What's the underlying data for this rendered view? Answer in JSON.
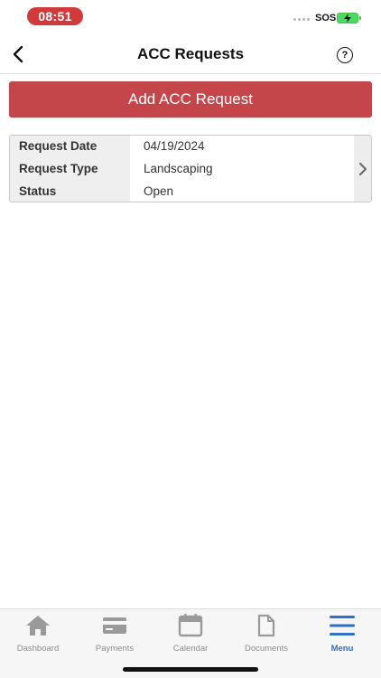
{
  "status_bar": {
    "time": "08:51",
    "carrier": "SOS"
  },
  "nav": {
    "title": "ACC Requests",
    "help_symbol": "?",
    "back_icon": "chevron-left-icon",
    "help_icon": "question-circle-icon"
  },
  "add_button": {
    "label": "Add ACC Request",
    "color": "#c4464a"
  },
  "request": {
    "date_label": "Request Date",
    "date_value": "04/19/2024",
    "type_label": "Request Type",
    "type_value": "Landscaping",
    "status_label": "Status",
    "status_value": "Open"
  },
  "tabs": [
    {
      "label": "Dashboard",
      "icon": "home-icon",
      "active": false
    },
    {
      "label": "Payments",
      "icon": "credit-card-icon",
      "active": false
    },
    {
      "label": "Calendar",
      "icon": "calendar-icon",
      "active": false
    },
    {
      "label": "Documents",
      "icon": "document-icon",
      "active": false
    },
    {
      "label": "Menu",
      "icon": "menu-icon",
      "active": true
    }
  ],
  "colors": {
    "accent": "#2f6fc7",
    "status_time": "#d03a3a"
  }
}
